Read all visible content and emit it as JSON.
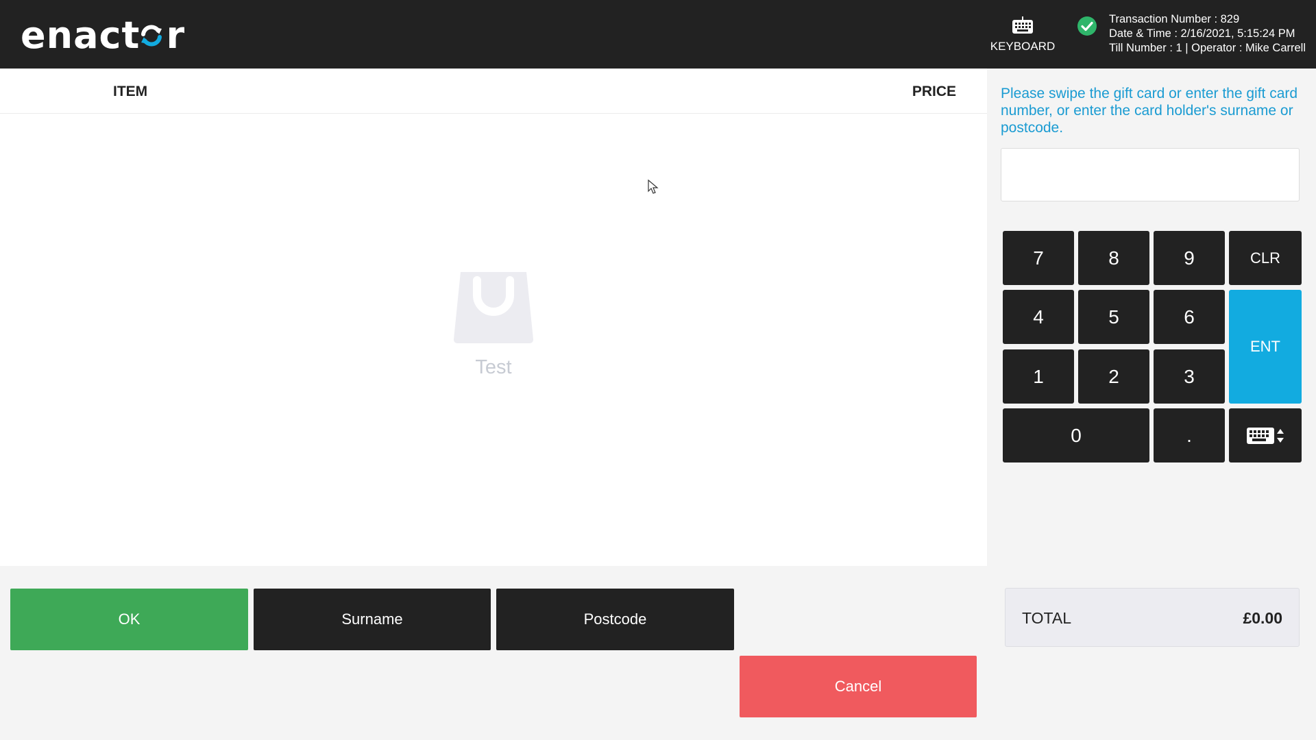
{
  "header": {
    "logo_text_before": "enact",
    "logo_text_after": "r",
    "keyboard_label": "KEYBOARD",
    "transaction_line": "Transaction Number : 829",
    "datetime_line": "Date & Time : 2/16/2021, 5:15:24 PM",
    "till_line": "Till Number : 1 | Operator : Mike Carrell"
  },
  "basket": {
    "item_header": "ITEM",
    "price_header": "PRICE",
    "empty_label": "Test"
  },
  "actions": {
    "ok": "OK",
    "surname": "Surname",
    "postcode": "Postcode",
    "cancel": "Cancel"
  },
  "entry": {
    "prompt": "Please swipe the gift card or enter the gift card number, or enter the card holder's surname or postcode.",
    "value": "",
    "placeholder": ""
  },
  "keypad": {
    "k7": "7",
    "k8": "8",
    "k9": "9",
    "clr": "CLR",
    "k4": "4",
    "k5": "5",
    "k6": "6",
    "ent": "ENT",
    "k1": "1",
    "k2": "2",
    "k3": "3",
    "k0": "0",
    "dot": "."
  },
  "total": {
    "label": "TOTAL",
    "value": "£0.00"
  },
  "colors": {
    "header_bg": "#222222",
    "ok_green": "#3ea957",
    "cancel_red": "#f05a5e",
    "enter_blue": "#12abe0",
    "prompt_blue": "#1a9bd2",
    "status_green": "#2fb56a"
  },
  "icons": {
    "logo_o": "refresh-cycle-icon",
    "keyboard": "keyboard-icon",
    "status": "check-circle-icon",
    "empty_basket": "shopping-bag-icon",
    "keypad_toggle": "keyboard-toggle-icon"
  }
}
